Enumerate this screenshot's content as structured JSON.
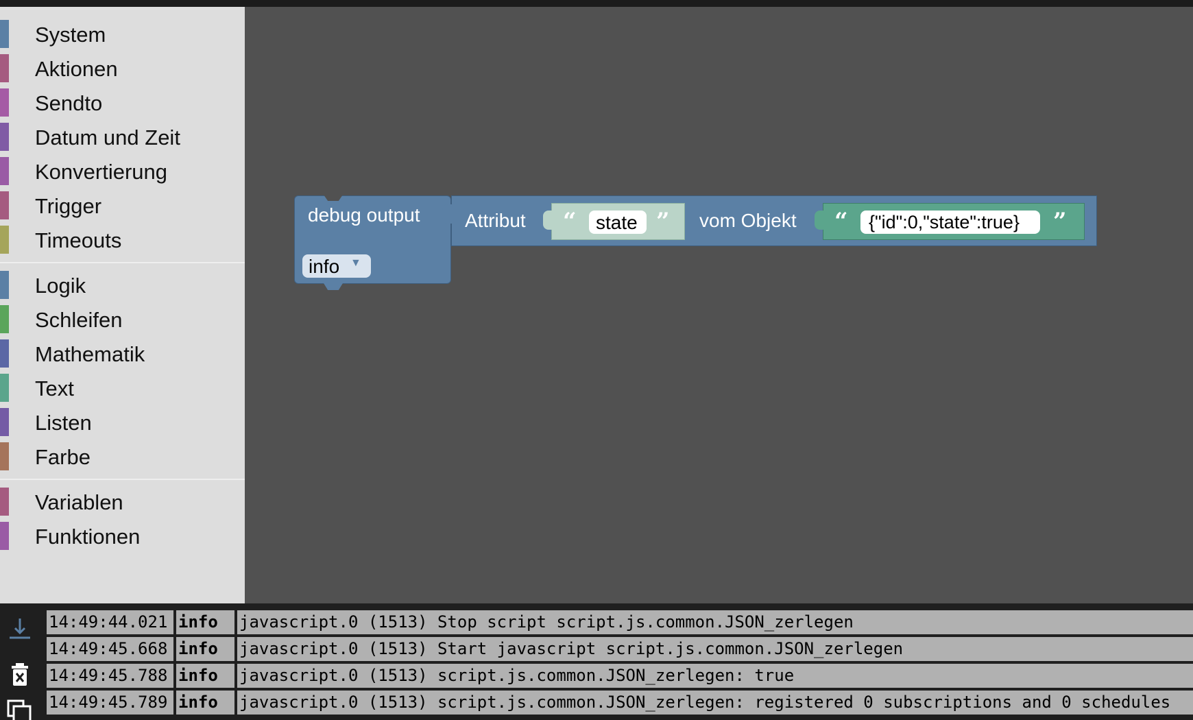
{
  "toolbox": {
    "groups": [
      [
        {
          "label": "System",
          "color": "#5b80a5"
        },
        {
          "label": "Aktionen",
          "color": "#a55b80"
        },
        {
          "label": "Sendto",
          "color": "#a55ba5"
        },
        {
          "label": "Datum und Zeit",
          "color": "#805ba5"
        },
        {
          "label": "Konvertierung",
          "color": "#9a5ba5"
        },
        {
          "label": "Trigger",
          "color": "#a55b80"
        },
        {
          "label": "Timeouts",
          "color": "#a5a55b"
        }
      ],
      [
        {
          "label": "Logik",
          "color": "#5b80a5"
        },
        {
          "label": "Schleifen",
          "color": "#5ba55b"
        },
        {
          "label": "Mathematik",
          "color": "#5b67a5"
        },
        {
          "label": "Text",
          "color": "#5ba58c"
        },
        {
          "label": "Listen",
          "color": "#745ba5"
        },
        {
          "label": "Farbe",
          "color": "#a5745b"
        }
      ],
      [
        {
          "label": "Variablen",
          "color": "#a55b80"
        },
        {
          "label": "Funktionen",
          "color": "#9a5ba5"
        }
      ]
    ]
  },
  "workspace": {
    "debug_block": {
      "label": "debug output",
      "level": "info"
    },
    "attribute_block": {
      "label": "Attribut",
      "attribute_value": "state",
      "object_label": "vom Objekt",
      "object_value": "{\"id\":0,\"state\":true}"
    }
  },
  "log": {
    "entries": [
      {
        "time": "14:49:44.021",
        "level": "info",
        "message": "javascript.0 (1513) Stop script script.js.common.JSON_zerlegen"
      },
      {
        "time": "14:49:45.668",
        "level": "info",
        "message": "javascript.0 (1513) Start javascript script.js.common.JSON_zerlegen"
      },
      {
        "time": "14:49:45.788",
        "level": "info",
        "message": "javascript.0 (1513) script.js.common.JSON_zerlegen: true"
      },
      {
        "time": "14:49:45.789",
        "level": "info",
        "message": "javascript.0 (1513) script.js.common.JSON_zerlegen: registered 0 subscriptions and 0 schedules"
      }
    ]
  }
}
